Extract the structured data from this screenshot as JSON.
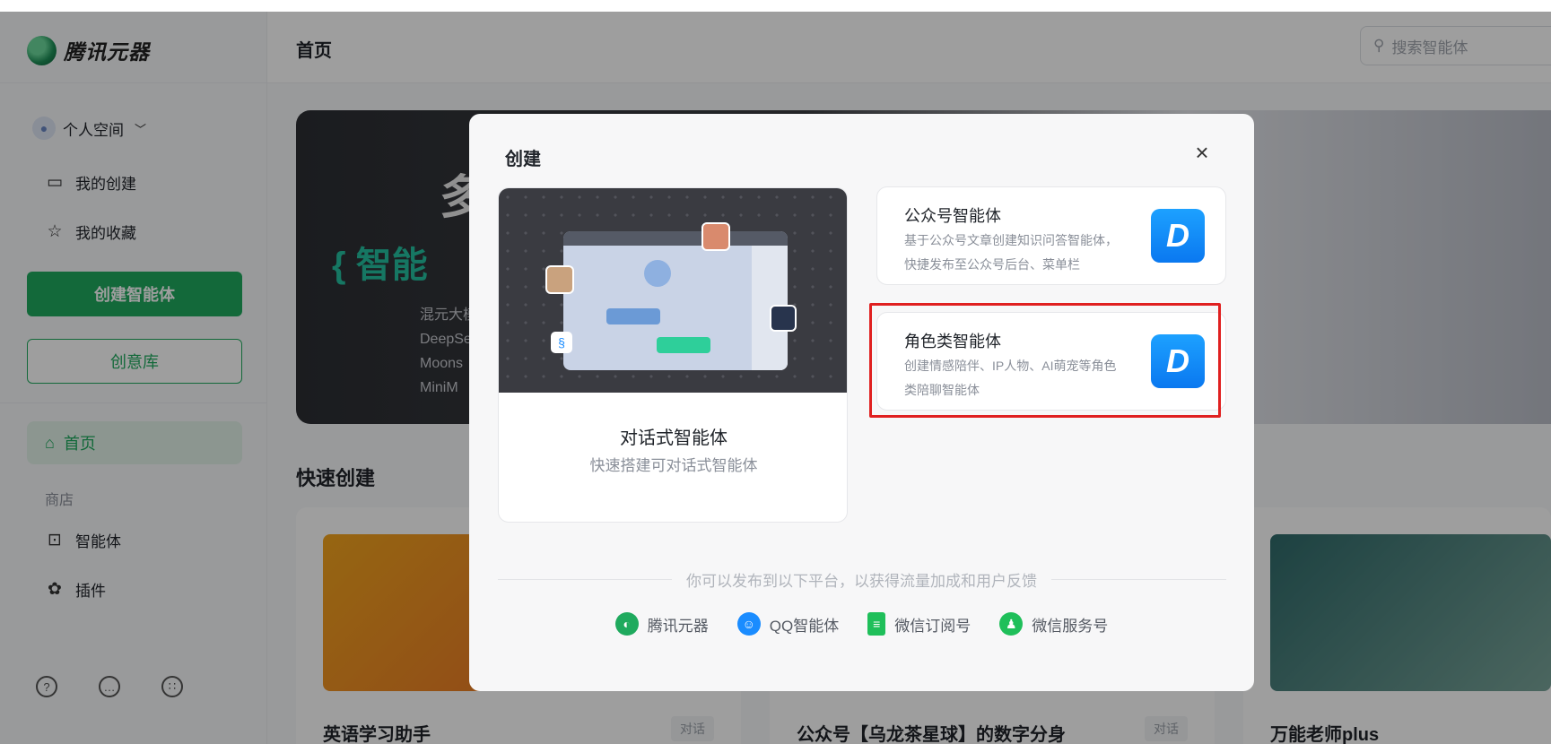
{
  "app": {
    "name": "腾讯元器",
    "page_title": "首页"
  },
  "search": {
    "placeholder": "搜索智能体"
  },
  "sidebar": {
    "space_label": "个人空间",
    "items": [
      {
        "label": "我的创建",
        "icon": "monitor-icon"
      },
      {
        "label": "我的收藏",
        "icon": "star-icon"
      }
    ],
    "create_button": "创建智能体",
    "idea_button": "创意库",
    "home_label": "首页",
    "shop_label": "商店",
    "shop_items": [
      {
        "label": "智能体",
        "icon": "robot-icon"
      },
      {
        "label": "插件",
        "icon": "puzzle-icon"
      }
    ]
  },
  "banner": {
    "big_text": "多",
    "sub_text": "{ 智能",
    "lines": [
      "混元大模",
      "DeepSe",
      "Moons",
      "MiniM"
    ]
  },
  "quick_create": {
    "title": "快速创建",
    "cards": [
      {
        "name": "英语学习助手",
        "tag": "对话"
      },
      {
        "name": "公众号【乌龙茶星球】的数字分身",
        "tag": "对话"
      },
      {
        "name": "万能老师plus",
        "tag": ""
      }
    ]
  },
  "modal": {
    "title": "创建",
    "close_label": "×",
    "conversational": {
      "title": "对话式智能体",
      "desc": "快速搭建可对话式智能体"
    },
    "options": [
      {
        "title": "公众号智能体",
        "desc": "基于公众号文章创建知识问答智能体， 快捷发布至公众号后台、菜单栏",
        "icon_letter": "D"
      },
      {
        "title": "角色类智能体",
        "desc": "创建情感陪伴、IP人物、AI萌宠等角色类陪聊智能体",
        "icon_letter": "D"
      }
    ],
    "publish_hint": "你可以发布到以下平台，以获得流量加成和用户反馈",
    "platforms": [
      {
        "label": "腾讯元器",
        "color": "#1faa5e"
      },
      {
        "label": "QQ智能体",
        "color": "#1a8cff"
      },
      {
        "label": "微信订阅号",
        "color": "#1fbf5a"
      },
      {
        "label": "微信服务号",
        "color": "#1fbf5a"
      }
    ]
  },
  "colors": {
    "accent": "#1faa5e",
    "highlight": "#e02020",
    "agent_icon": "#0a78f0"
  }
}
